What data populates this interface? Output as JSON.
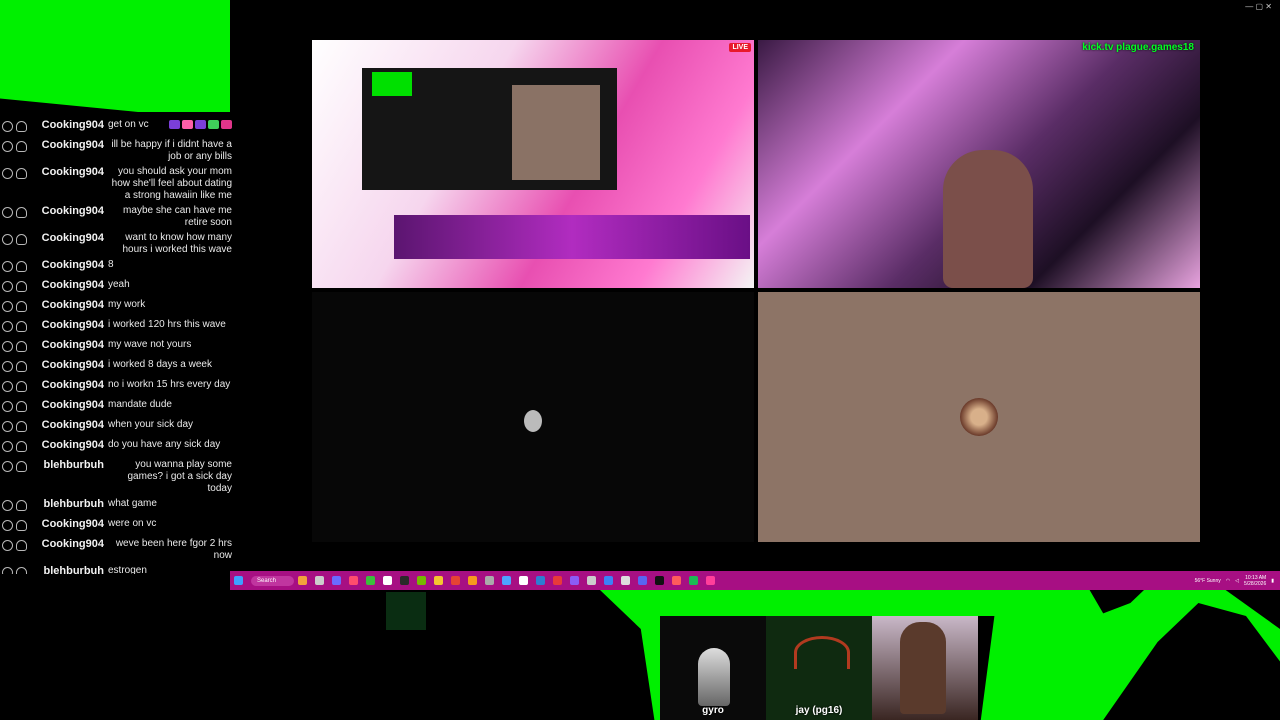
{
  "chat": {
    "messages": [
      {
        "user": "Cooking904",
        "text": "get on vc",
        "badges": true,
        "align": "left"
      },
      {
        "user": "Cooking904",
        "text": "ill be happy if i didnt have a job or any bills",
        "align": "right"
      },
      {
        "user": "Cooking904",
        "text": "you should ask your mom how she'll feel about dating a strong hawaiin like me",
        "align": "right"
      },
      {
        "user": "Cooking904",
        "text": "maybe she can have me retire soon",
        "align": "right"
      },
      {
        "user": "Cooking904",
        "text": "want to know how many hours i worked this wave",
        "align": "right"
      },
      {
        "user": "Cooking904",
        "text": "8",
        "align": "left"
      },
      {
        "user": "Cooking904",
        "text": "yeah",
        "align": "left"
      },
      {
        "user": "Cooking904",
        "text": "my work",
        "align": "left"
      },
      {
        "user": "Cooking904",
        "text": "i worked 120 hrs this wave",
        "align": "left"
      },
      {
        "user": "Cooking904",
        "text": "my wave not yours",
        "align": "left"
      },
      {
        "user": "Cooking904",
        "text": "i worked 8 days a week",
        "align": "left"
      },
      {
        "user": "Cooking904",
        "text": "no i workn 15 hrs every day",
        "align": "left"
      },
      {
        "user": "Cooking904",
        "text": "mandate dude",
        "align": "left"
      },
      {
        "user": "Cooking904",
        "text": "when your sick day",
        "align": "left"
      },
      {
        "user": "Cooking904",
        "text": "do you have any sick day",
        "align": "left"
      },
      {
        "user": "blehburbuh",
        "text": "you wanna play some games? i got a sick day today",
        "align": "right"
      },
      {
        "user": "blehburbuh",
        "text": "what game",
        "align": "left"
      },
      {
        "user": "Cooking904",
        "text": "were on vc",
        "align": "left"
      },
      {
        "user": "Cooking904",
        "text": "weve been here fgor 2 hrs now",
        "align": "right"
      },
      {
        "user": "blehburbuh",
        "text": "estrogen",
        "align": "left"
      }
    ]
  },
  "tiles": {
    "screen_live": "LIVE",
    "cam_overlay": "kick.tv plague.games18"
  },
  "participants": [
    {
      "name": "gyro"
    },
    {
      "name": "jay (pg16)"
    },
    {
      "name": ""
    }
  ],
  "taskbar": {
    "search_label": "Search",
    "weather": "56°F Sunny",
    "time": "10:13 AM",
    "date": "5/28/2026"
  },
  "colors": {
    "chroma_green": "#00f000",
    "taskbar": "#a70f83",
    "brown_tile": "#8d7466"
  }
}
